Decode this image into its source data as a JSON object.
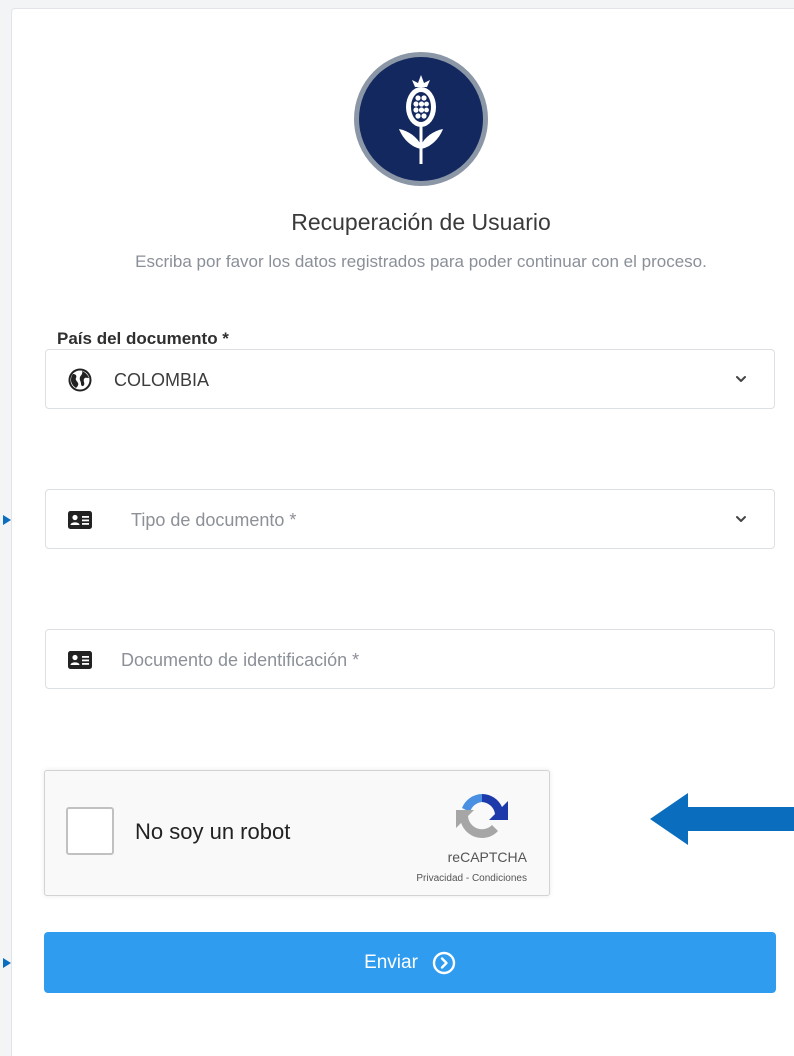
{
  "header": {
    "title": "Recuperación de Usuario",
    "subtitle": "Escriba por favor los datos registrados para poder continuar con el proceso."
  },
  "country": {
    "label": "País del documento *",
    "value": "COLOMBIA",
    "icon": "globe-icon"
  },
  "doc_type": {
    "placeholder": "Tipo de documento *",
    "icon": "id-card-icon"
  },
  "doc_number": {
    "placeholder": "Documento de identificación *",
    "icon": "id-card-icon"
  },
  "recaptcha": {
    "label": "No soy un robot",
    "brand": "reCAPTCHA",
    "links": "Privacidad - Condiciones"
  },
  "submit": {
    "label": "Enviar",
    "icon": "chevron-circle-right-icon",
    "color": "#2f9cf0"
  },
  "colors": {
    "logo_navy": "#13285e",
    "annotation_arrow": "#0a6dbd"
  }
}
